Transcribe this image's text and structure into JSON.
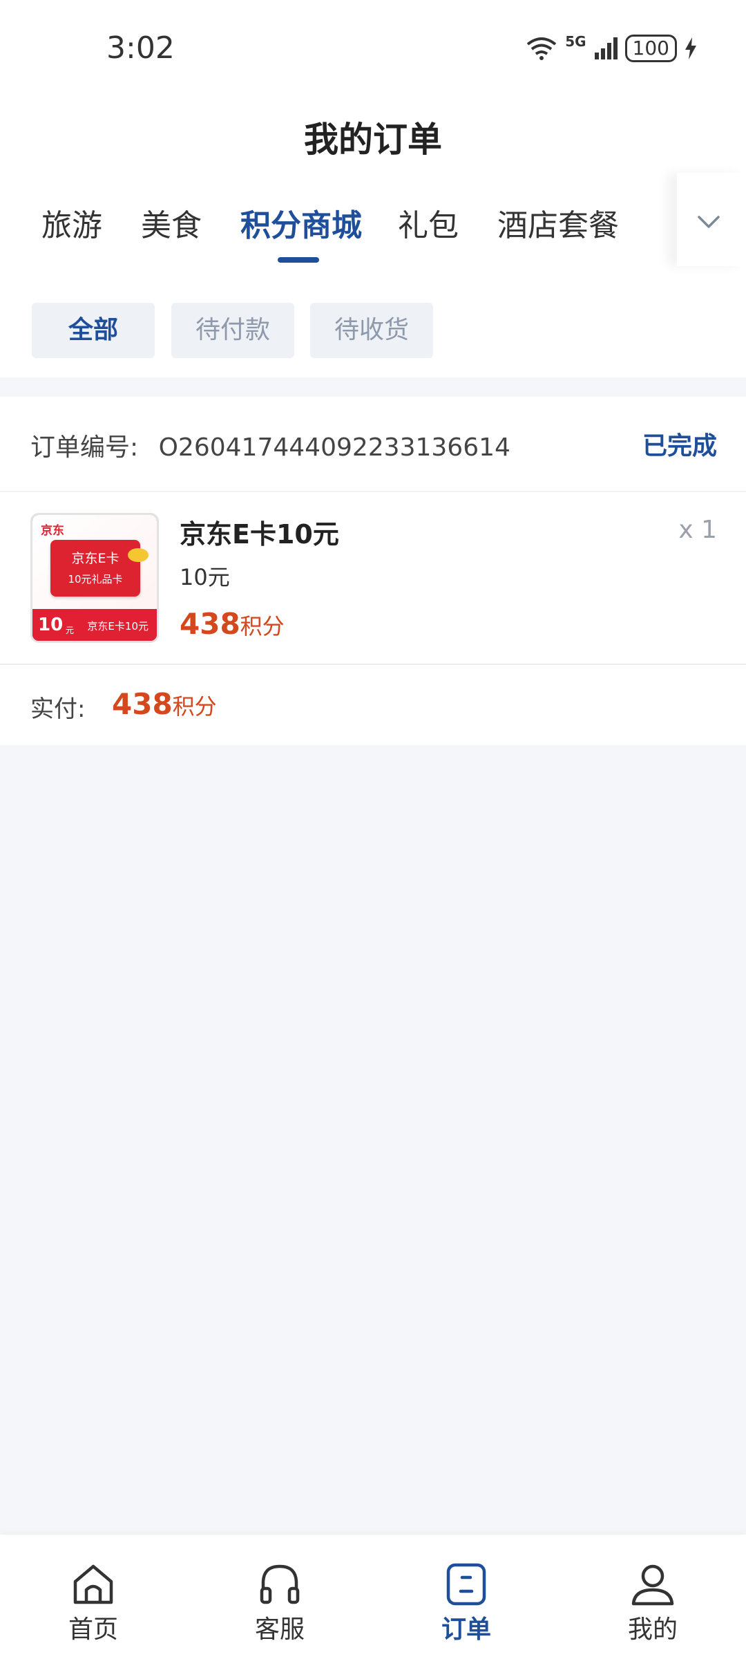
{
  "status_bar": {
    "time": "3:02",
    "network": "5G",
    "battery": "100"
  },
  "header": {
    "title": "我的订单"
  },
  "tabs": [
    {
      "label": "旅游",
      "active": false
    },
    {
      "label": "美食",
      "active": false
    },
    {
      "label": "积分商城",
      "active": true
    },
    {
      "label": "礼包",
      "active": false
    },
    {
      "label": "酒店套餐",
      "active": false
    }
  ],
  "filters": [
    {
      "label": "全部",
      "active": true
    },
    {
      "label": "待付款",
      "active": false
    },
    {
      "label": "待收货",
      "active": false
    }
  ],
  "order": {
    "number_label": "订单编号:",
    "number": "O260417444092233136614",
    "status": "已完成",
    "product": {
      "thumb_logo": "京东",
      "thumb_card_title": "京东E卡",
      "thumb_card_subtitle": "10元礼品卡",
      "thumb_value": "10",
      "thumb_unit": "元",
      "thumb_name": "京东E卡10元",
      "name": "京东E卡10元",
      "spec": "10元",
      "price": "438",
      "price_unit": "积分",
      "quantity": "x 1"
    },
    "paid_label": "实付:",
    "paid_amount": "438",
    "paid_unit": "积分"
  },
  "nav": [
    {
      "label": "首页",
      "icon": "home-icon",
      "active": false
    },
    {
      "label": "客服",
      "icon": "headset-icon",
      "active": false
    },
    {
      "label": "订单",
      "icon": "order-icon",
      "active": true
    },
    {
      "label": "我的",
      "icon": "profile-icon",
      "active": false
    }
  ],
  "colors": {
    "accent": "#1f4e9b",
    "price": "#d4481d",
    "background": "#f4f6f9"
  }
}
